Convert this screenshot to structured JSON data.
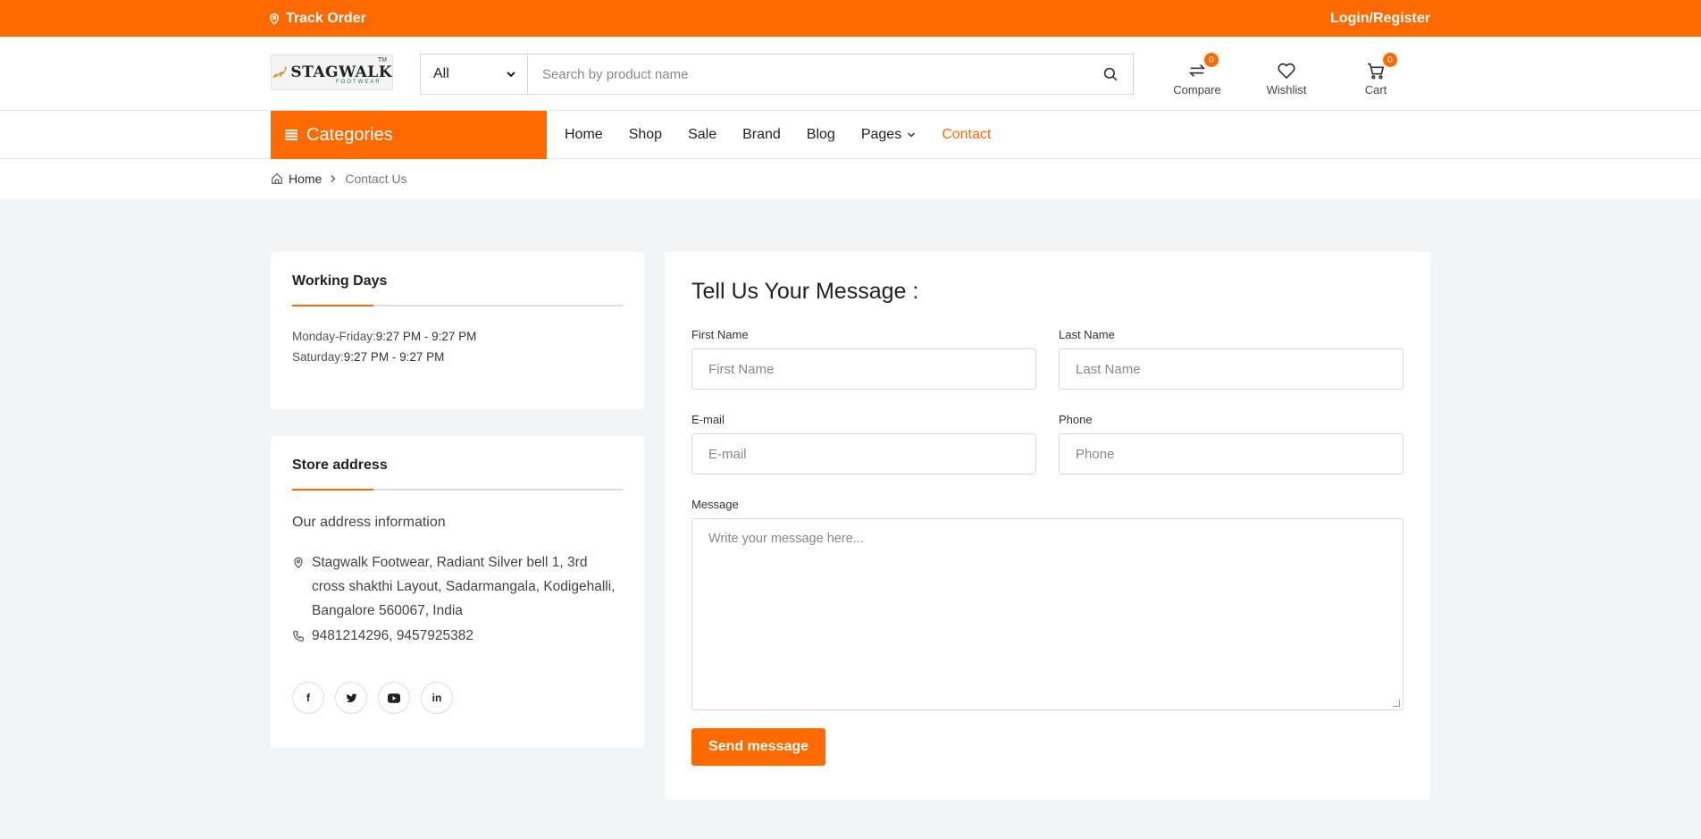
{
  "topbar": {
    "track_label": "Track Order",
    "login_label": "Login/Register"
  },
  "header": {
    "logo_text": "STAGWALK",
    "logo_sub": "FOOTWEAR",
    "logo_tm": "TM",
    "category_select": "All",
    "search_placeholder": "Search by product name",
    "compare": {
      "label": "Compare",
      "count": "0"
    },
    "wishlist": {
      "label": "Wishlist"
    },
    "cart": {
      "label": "Cart",
      "count": "0"
    }
  },
  "nav": {
    "categories_label": "Categories",
    "items": [
      {
        "label": "Home"
      },
      {
        "label": "Shop"
      },
      {
        "label": "Sale"
      },
      {
        "label": "Brand"
      },
      {
        "label": "Blog"
      },
      {
        "label": "Pages"
      },
      {
        "label": "Contact"
      }
    ]
  },
  "breadcrumb": {
    "home": "Home",
    "current": "Contact Us"
  },
  "working_days": {
    "title": "Working Days",
    "lines": [
      {
        "day": "Monday-Friday:",
        "time": "9:27 PM - 9:27 PM"
      },
      {
        "day": "Saturday:",
        "time": "9:27 PM - 9:27 PM"
      }
    ]
  },
  "store_address": {
    "title": "Store address",
    "subtitle": "Our address information",
    "address": "Stagwalk Footwear, Radiant Silver bell 1, 3rd cross shakthi Layout, Sadarmangala, Kodigehalli, Bangalore 560067, India",
    "phone": "9481214296, 9457925382",
    "socials": [
      "f",
      "t",
      "yt",
      "in"
    ]
  },
  "form": {
    "title": "Tell Us Your Message :",
    "first_name": {
      "label": "First Name",
      "placeholder": "First Name"
    },
    "last_name": {
      "label": "Last Name",
      "placeholder": "Last Name"
    },
    "email": {
      "label": "E-mail",
      "placeholder": "E-mail"
    },
    "phone": {
      "label": "Phone",
      "placeholder": "Phone"
    },
    "message": {
      "label": "Message",
      "placeholder": "Write your message here..."
    },
    "submit_label": "Send message"
  },
  "colors": {
    "accent": "#ff6a00",
    "page_bg": "#f3f4f6"
  }
}
